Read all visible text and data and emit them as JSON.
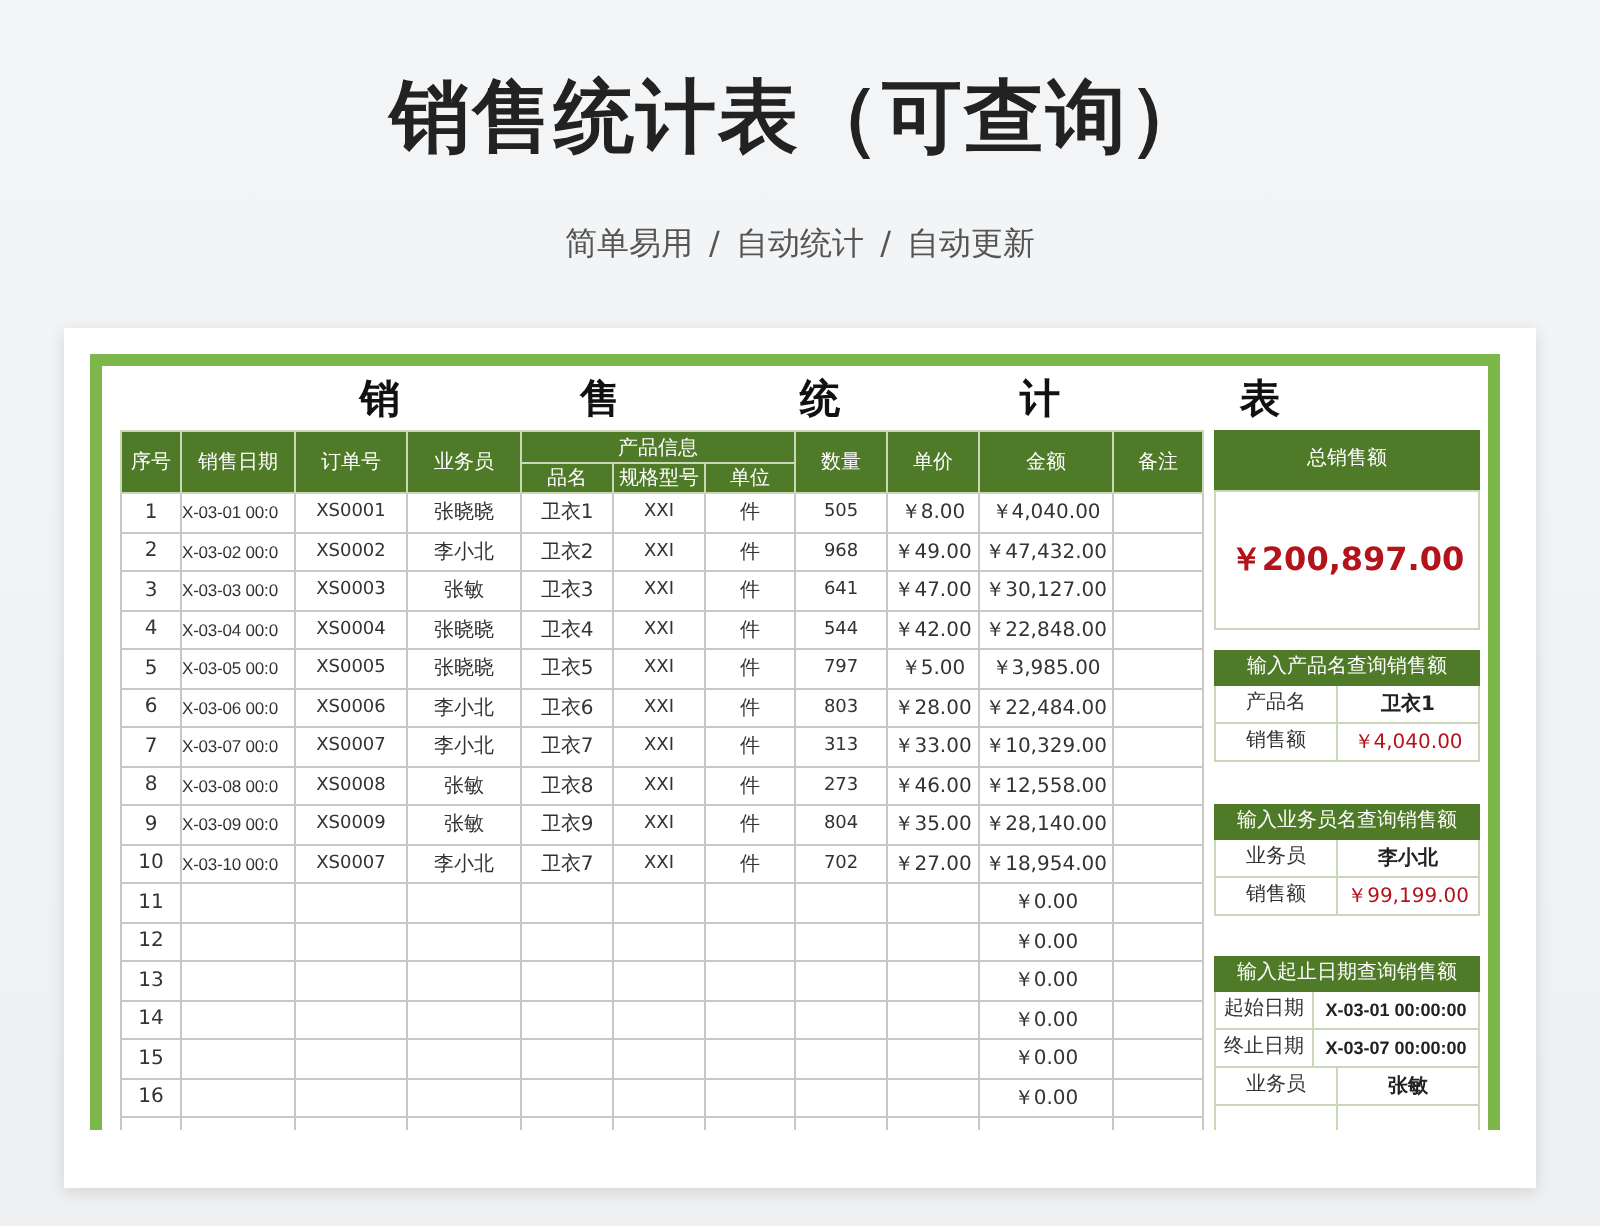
{
  "page_title": "销售统计表（可查询）",
  "subtitle": "简单易用 / 自动统计 / 自动更新",
  "sheet_title_chars": [
    "销",
    "售",
    "统",
    "计",
    "表"
  ],
  "table": {
    "columns": [
      "序号",
      "销售日期",
      "订单号",
      "业务员",
      "数量",
      "单价",
      "金额",
      "备注"
    ],
    "group_header": "产品信息",
    "group_columns": [
      "品名",
      "规格型号",
      "单位"
    ],
    "rows": [
      {
        "no": "1",
        "date": "X-03-01 00:0",
        "order": "XS0001",
        "person": "张晓晓",
        "product": "卫衣1",
        "spec": "XXI",
        "unit": "件",
        "qty": "505",
        "price": "￥8.00",
        "amount": "￥4,040.00"
      },
      {
        "no": "2",
        "date": "X-03-02 00:0",
        "order": "XS0002",
        "person": "李小北",
        "product": "卫衣2",
        "spec": "XXI",
        "unit": "件",
        "qty": "968",
        "price": "￥49.00",
        "amount": "￥47,432.00"
      },
      {
        "no": "3",
        "date": "X-03-03 00:0",
        "order": "XS0003",
        "person": "张敏",
        "product": "卫衣3",
        "spec": "XXI",
        "unit": "件",
        "qty": "641",
        "price": "￥47.00",
        "amount": "￥30,127.00"
      },
      {
        "no": "4",
        "date": "X-03-04 00:0",
        "order": "XS0004",
        "person": "张晓晓",
        "product": "卫衣4",
        "spec": "XXI",
        "unit": "件",
        "qty": "544",
        "price": "￥42.00",
        "amount": "￥22,848.00"
      },
      {
        "no": "5",
        "date": "X-03-05 00:0",
        "order": "XS0005",
        "person": "张晓晓",
        "product": "卫衣5",
        "spec": "XXI",
        "unit": "件",
        "qty": "797",
        "price": "￥5.00",
        "amount": "￥3,985.00"
      },
      {
        "no": "6",
        "date": "X-03-06 00:0",
        "order": "XS0006",
        "person": "李小北",
        "product": "卫衣6",
        "spec": "XXI",
        "unit": "件",
        "qty": "803",
        "price": "￥28.00",
        "amount": "￥22,484.00"
      },
      {
        "no": "7",
        "date": "X-03-07 00:0",
        "order": "XS0007",
        "person": "李小北",
        "product": "卫衣7",
        "spec": "XXI",
        "unit": "件",
        "qty": "313",
        "price": "￥33.00",
        "amount": "￥10,329.00"
      },
      {
        "no": "8",
        "date": "X-03-08 00:0",
        "order": "XS0008",
        "person": "张敏",
        "product": "卫衣8",
        "spec": "XXI",
        "unit": "件",
        "qty": "273",
        "price": "￥46.00",
        "amount": "￥12,558.00"
      },
      {
        "no": "9",
        "date": "X-03-09 00:0",
        "order": "XS0009",
        "person": "张敏",
        "product": "卫衣9",
        "spec": "XXI",
        "unit": "件",
        "qty": "804",
        "price": "￥35.00",
        "amount": "￥28,140.00"
      },
      {
        "no": "10",
        "date": "X-03-10 00:0",
        "order": "XS0007",
        "person": "李小北",
        "product": "卫衣7",
        "spec": "XXI",
        "unit": "件",
        "qty": "702",
        "price": "￥27.00",
        "amount": "￥18,954.00"
      },
      {
        "no": "11",
        "amount": "￥0.00"
      },
      {
        "no": "12",
        "amount": "￥0.00"
      },
      {
        "no": "13",
        "amount": "￥0.00"
      },
      {
        "no": "14",
        "amount": "￥0.00"
      },
      {
        "no": "15",
        "amount": "￥0.00"
      },
      {
        "no": "16",
        "amount": "￥0.00"
      }
    ]
  },
  "total": {
    "header": "总销售额",
    "value": "￥200,897.00"
  },
  "queries": [
    {
      "header": "输入产品名查询销售额",
      "rows": [
        {
          "label": "产品名",
          "value": "卫衣1",
          "kind": "input"
        },
        {
          "label": "销售额",
          "value": "￥4,040.00",
          "kind": "result"
        }
      ]
    },
    {
      "header": "输入业务员名查询销售额",
      "rows": [
        {
          "label": "业务员",
          "value": "李小北",
          "kind": "input"
        },
        {
          "label": "销售额",
          "value": "￥99,199.00",
          "kind": "result"
        }
      ]
    },
    {
      "header": "输入起止日期查询销售额",
      "rows": [
        {
          "label": "起始日期",
          "value": "X-03-01 00:00:00",
          "kind": "date"
        },
        {
          "label": "终止日期",
          "value": "X-03-07 00:00:00",
          "kind": "date"
        },
        {
          "label": "业务员",
          "value": "张敏",
          "kind": "input"
        }
      ]
    }
  ]
}
